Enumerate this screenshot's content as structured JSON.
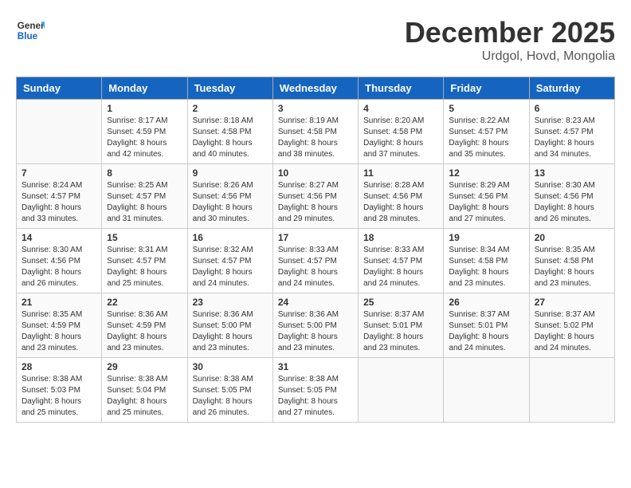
{
  "header": {
    "logo_line1": "General",
    "logo_line2": "Blue",
    "month_title": "December 2025",
    "location": "Urdgol, Hovd, Mongolia"
  },
  "days_of_week": [
    "Sunday",
    "Monday",
    "Tuesday",
    "Wednesday",
    "Thursday",
    "Friday",
    "Saturday"
  ],
  "weeks": [
    [
      {
        "day": "",
        "info": ""
      },
      {
        "day": "1",
        "info": "Sunrise: 8:17 AM\nSunset: 4:59 PM\nDaylight: 8 hours\nand 42 minutes."
      },
      {
        "day": "2",
        "info": "Sunrise: 8:18 AM\nSunset: 4:58 PM\nDaylight: 8 hours\nand 40 minutes."
      },
      {
        "day": "3",
        "info": "Sunrise: 8:19 AM\nSunset: 4:58 PM\nDaylight: 8 hours\nand 38 minutes."
      },
      {
        "day": "4",
        "info": "Sunrise: 8:20 AM\nSunset: 4:58 PM\nDaylight: 8 hours\nand 37 minutes."
      },
      {
        "day": "5",
        "info": "Sunrise: 8:22 AM\nSunset: 4:57 PM\nDaylight: 8 hours\nand 35 minutes."
      },
      {
        "day": "6",
        "info": "Sunrise: 8:23 AM\nSunset: 4:57 PM\nDaylight: 8 hours\nand 34 minutes."
      }
    ],
    [
      {
        "day": "7",
        "info": "Sunrise: 8:24 AM\nSunset: 4:57 PM\nDaylight: 8 hours\nand 33 minutes."
      },
      {
        "day": "8",
        "info": "Sunrise: 8:25 AM\nSunset: 4:57 PM\nDaylight: 8 hours\nand 31 minutes."
      },
      {
        "day": "9",
        "info": "Sunrise: 8:26 AM\nSunset: 4:56 PM\nDaylight: 8 hours\nand 30 minutes."
      },
      {
        "day": "10",
        "info": "Sunrise: 8:27 AM\nSunset: 4:56 PM\nDaylight: 8 hours\nand 29 minutes."
      },
      {
        "day": "11",
        "info": "Sunrise: 8:28 AM\nSunset: 4:56 PM\nDaylight: 8 hours\nand 28 minutes."
      },
      {
        "day": "12",
        "info": "Sunrise: 8:29 AM\nSunset: 4:56 PM\nDaylight: 8 hours\nand 27 minutes."
      },
      {
        "day": "13",
        "info": "Sunrise: 8:30 AM\nSunset: 4:56 PM\nDaylight: 8 hours\nand 26 minutes."
      }
    ],
    [
      {
        "day": "14",
        "info": "Sunrise: 8:30 AM\nSunset: 4:56 PM\nDaylight: 8 hours\nand 26 minutes."
      },
      {
        "day": "15",
        "info": "Sunrise: 8:31 AM\nSunset: 4:57 PM\nDaylight: 8 hours\nand 25 minutes."
      },
      {
        "day": "16",
        "info": "Sunrise: 8:32 AM\nSunset: 4:57 PM\nDaylight: 8 hours\nand 24 minutes."
      },
      {
        "day": "17",
        "info": "Sunrise: 8:33 AM\nSunset: 4:57 PM\nDaylight: 8 hours\nand 24 minutes."
      },
      {
        "day": "18",
        "info": "Sunrise: 8:33 AM\nSunset: 4:57 PM\nDaylight: 8 hours\nand 24 minutes."
      },
      {
        "day": "19",
        "info": "Sunrise: 8:34 AM\nSunset: 4:58 PM\nDaylight: 8 hours\nand 23 minutes."
      },
      {
        "day": "20",
        "info": "Sunrise: 8:35 AM\nSunset: 4:58 PM\nDaylight: 8 hours\nand 23 minutes."
      }
    ],
    [
      {
        "day": "21",
        "info": "Sunrise: 8:35 AM\nSunset: 4:59 PM\nDaylight: 8 hours\nand 23 minutes."
      },
      {
        "day": "22",
        "info": "Sunrise: 8:36 AM\nSunset: 4:59 PM\nDaylight: 8 hours\nand 23 minutes."
      },
      {
        "day": "23",
        "info": "Sunrise: 8:36 AM\nSunset: 5:00 PM\nDaylight: 8 hours\nand 23 minutes."
      },
      {
        "day": "24",
        "info": "Sunrise: 8:36 AM\nSunset: 5:00 PM\nDaylight: 8 hours\nand 23 minutes."
      },
      {
        "day": "25",
        "info": "Sunrise: 8:37 AM\nSunset: 5:01 PM\nDaylight: 8 hours\nand 23 minutes."
      },
      {
        "day": "26",
        "info": "Sunrise: 8:37 AM\nSunset: 5:01 PM\nDaylight: 8 hours\nand 24 minutes."
      },
      {
        "day": "27",
        "info": "Sunrise: 8:37 AM\nSunset: 5:02 PM\nDaylight: 8 hours\nand 24 minutes."
      }
    ],
    [
      {
        "day": "28",
        "info": "Sunrise: 8:38 AM\nSunset: 5:03 PM\nDaylight: 8 hours\nand 25 minutes."
      },
      {
        "day": "29",
        "info": "Sunrise: 8:38 AM\nSunset: 5:04 PM\nDaylight: 8 hours\nand 25 minutes."
      },
      {
        "day": "30",
        "info": "Sunrise: 8:38 AM\nSunset: 5:05 PM\nDaylight: 8 hours\nand 26 minutes."
      },
      {
        "day": "31",
        "info": "Sunrise: 8:38 AM\nSunset: 5:05 PM\nDaylight: 8 hours\nand 27 minutes."
      },
      {
        "day": "",
        "info": ""
      },
      {
        "day": "",
        "info": ""
      },
      {
        "day": "",
        "info": ""
      }
    ]
  ]
}
